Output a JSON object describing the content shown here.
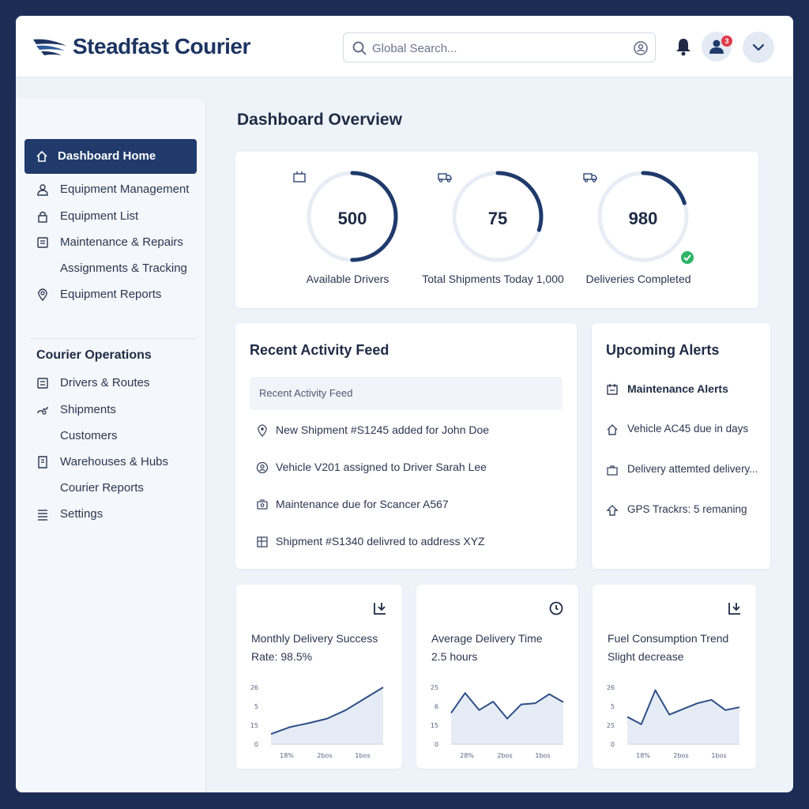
{
  "header": {
    "brand": "Steadfast Courier",
    "search_placeholder": "Global Search...",
    "notification_count": "3"
  },
  "sidebar": {
    "active": "Dashboard Home",
    "group1": [
      "Equipment Management",
      "Equipment List",
      "Maintenance & Repairs",
      "Assignments & Tracking",
      "Equipment Reports"
    ],
    "section": "Courier Operations",
    "group2": [
      "Drivers & Routes",
      "Shipments",
      "Customers",
      "Warehouses & Hubs",
      "Courier Reports",
      "Settings"
    ]
  },
  "page_title": "Dashboard Overview",
  "stats": [
    {
      "value": "500",
      "caption": "Available Drivers",
      "progress": 0.5
    },
    {
      "value": "75",
      "caption": "Total Shipments Today 1,000",
      "progress": 0.3
    },
    {
      "value": "980",
      "caption": "Deliveries Completed",
      "progress": 0.2
    }
  ],
  "feed": {
    "title": "Recent Activity Feed",
    "header": "Recent Activity Feed",
    "items": [
      "New Shipment #S1245 added for John Doe",
      "Vehicle V201 assigned to Driver Sarah Lee",
      "Maintenance due for Scancer A567",
      "Shipment #S1340 delivred to address XYZ"
    ]
  },
  "alerts": {
    "title": "Upcoming Alerts",
    "items": [
      "Maintenance Alerts",
      "Vehicle AC45 due in days",
      "Delivery attemted delivery...",
      "GPS Trackrs: 5 remaning"
    ]
  },
  "mini_charts": [
    {
      "line1": "Monthly Delivery Success",
      "line2": "Rate: 98.5%"
    },
    {
      "line1": "Average Delivery Time",
      "line2": "2.5 hours"
    },
    {
      "line1": "Fuel Consumption Trend",
      "line2": "Slight decrease"
    }
  ],
  "chart_data": [
    {
      "type": "area",
      "title": "Monthly Delivery Success",
      "y_ticks": [
        "26",
        "5",
        "15",
        "0"
      ],
      "x_ticks": [
        "18%",
        "2bos",
        "1bos"
      ],
      "values": [
        0.18,
        0.3,
        0.37,
        0.45,
        0.6,
        0.8,
        1.0
      ]
    },
    {
      "type": "area",
      "title": "Average Delivery Time",
      "y_ticks": [
        "25",
        "6",
        "15",
        "0"
      ],
      "x_ticks": [
        "28%",
        "2bos",
        "1bos"
      ],
      "values": [
        0.55,
        0.9,
        0.6,
        0.75,
        0.45,
        0.7,
        0.72,
        0.88,
        0.74
      ]
    },
    {
      "type": "area",
      "title": "Fuel Consumption Trend",
      "y_ticks": [
        "26",
        "5",
        "25",
        "0"
      ],
      "x_ticks": [
        "18%",
        "2bos",
        "1bos"
      ],
      "values": [
        0.48,
        0.35,
        0.95,
        0.52,
        0.62,
        0.72,
        0.78,
        0.6,
        0.65
      ]
    }
  ],
  "colors": {
    "primary": "#1f3a6b",
    "accent_line": "#2e4e86",
    "success": "#2fb46a",
    "alert": "#e03b4a"
  }
}
